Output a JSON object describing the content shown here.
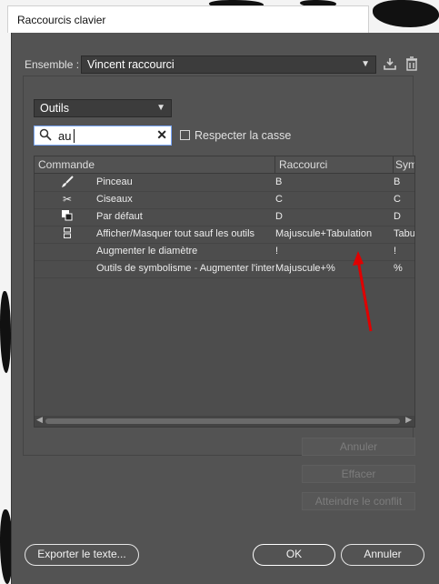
{
  "window": {
    "title": "Raccourcis clavier"
  },
  "ensemble": {
    "label": "Ensemble :",
    "value": "Vincent raccourci"
  },
  "icons": {
    "save": "save-icon",
    "trash": "trash-icon"
  },
  "category": {
    "value": "Outils"
  },
  "search": {
    "value": "au",
    "case_label": "Respecter la casse",
    "case_checked": false
  },
  "table": {
    "columns": [
      "Commande",
      "Raccourci",
      "Sym"
    ],
    "rows": [
      {
        "icon": "brush-icon",
        "command": "Pinceau",
        "shortcut": "B",
        "symbol": "B"
      },
      {
        "icon": "scissors-icon",
        "command": "Ciseaux",
        "shortcut": "C",
        "symbol": "C"
      },
      {
        "icon": "default-colors-icon",
        "command": "Par défaut",
        "shortcut": "D",
        "symbol": "D"
      },
      {
        "icon": "toolbar-toggle-icon",
        "command": "Afficher/Masquer tout sauf les outils",
        "shortcut": "Majuscule+Tabulation",
        "symbol": "Tabu"
      },
      {
        "icon": "",
        "command": "Augmenter le diamètre",
        "shortcut": "!",
        "symbol": "!"
      },
      {
        "icon": "",
        "command": "Outils de symbolisme - Augmenter l'inter",
        "shortcut": "Majuscule+%",
        "symbol": "%"
      }
    ]
  },
  "actions": {
    "undo": "Annuler",
    "clear": "Effacer",
    "goto_conflict": "Atteindre le conflit"
  },
  "footer": {
    "export": "Exporter le texte...",
    "ok": "OK",
    "cancel": "Annuler"
  },
  "colors": {
    "dialog_bg": "#535353",
    "annotation_arrow": "#e00000"
  }
}
